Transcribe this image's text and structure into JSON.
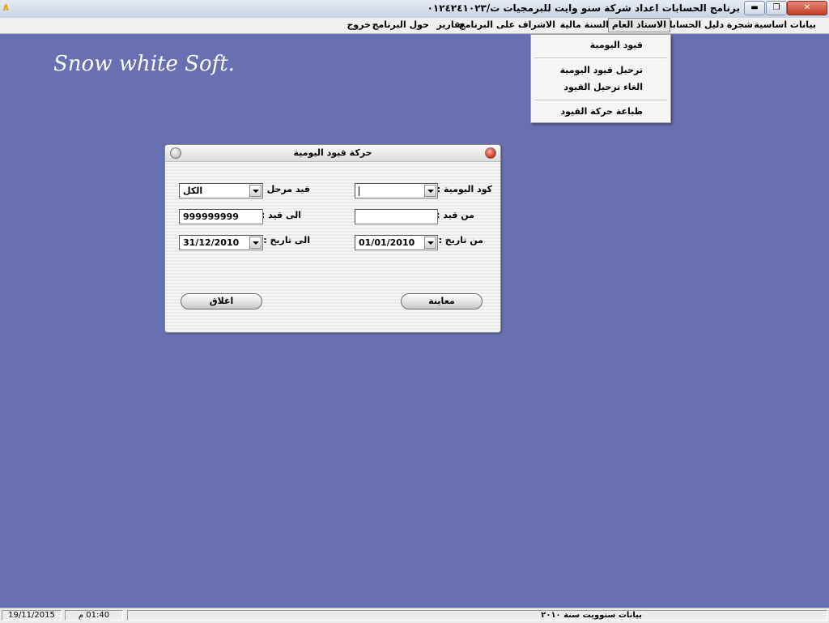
{
  "window": {
    "title": "برنامج الحسابات اعداد شركة سنو وايت للبرمجيات ت/٠١٢٤٢٤١٠٢٣",
    "minimize": "▬",
    "restore": "❐",
    "close": "✕"
  },
  "menu": {
    "items": [
      {
        "label": "بيانات اساسية"
      },
      {
        "label": "شجرة دليل الحسابات"
      },
      {
        "label": "الاستاذ العام"
      },
      {
        "label": "السنة مالية"
      },
      {
        "label": "الاشراف على البرنامج"
      },
      {
        "label": "تقارير"
      },
      {
        "label": "حول البرنامج"
      },
      {
        "label": "خروج"
      }
    ],
    "active": "الاستاذ العام"
  },
  "dropdown": {
    "items": [
      {
        "label": "قيود اليومية"
      },
      {
        "label": "ترحيل قيود اليومية"
      },
      {
        "label": "الغاء ترحيل القيود"
      },
      {
        "label": "طباعة حركة القيود"
      }
    ]
  },
  "brand": "Snow white Soft.",
  "dialog": {
    "title": "حركة قيود اليومية",
    "labels": {
      "journal_code": "كود اليومية :",
      "posted": "قيد مرحل :",
      "from_entry": "من قيد :",
      "to_entry": "الى قيد :",
      "from_date": "من تاريخ :",
      "to_date": "الى تاريخ :"
    },
    "values": {
      "journal_code": "",
      "posted": "الكل",
      "from_entry": "",
      "to_entry": "999999999",
      "from_date": "01/01/2010",
      "to_date": "31/12/2010"
    },
    "buttons": {
      "preview": "معاينة",
      "close": "اغلاق"
    }
  },
  "status": {
    "date": "19/11/2015",
    "time": "01:40 م",
    "company": "بيانات سنوويت سنة ٢٠١٠"
  },
  "colors": {
    "desktop": "#6870b2",
    "dialog_close_dot": "#d2321e"
  }
}
